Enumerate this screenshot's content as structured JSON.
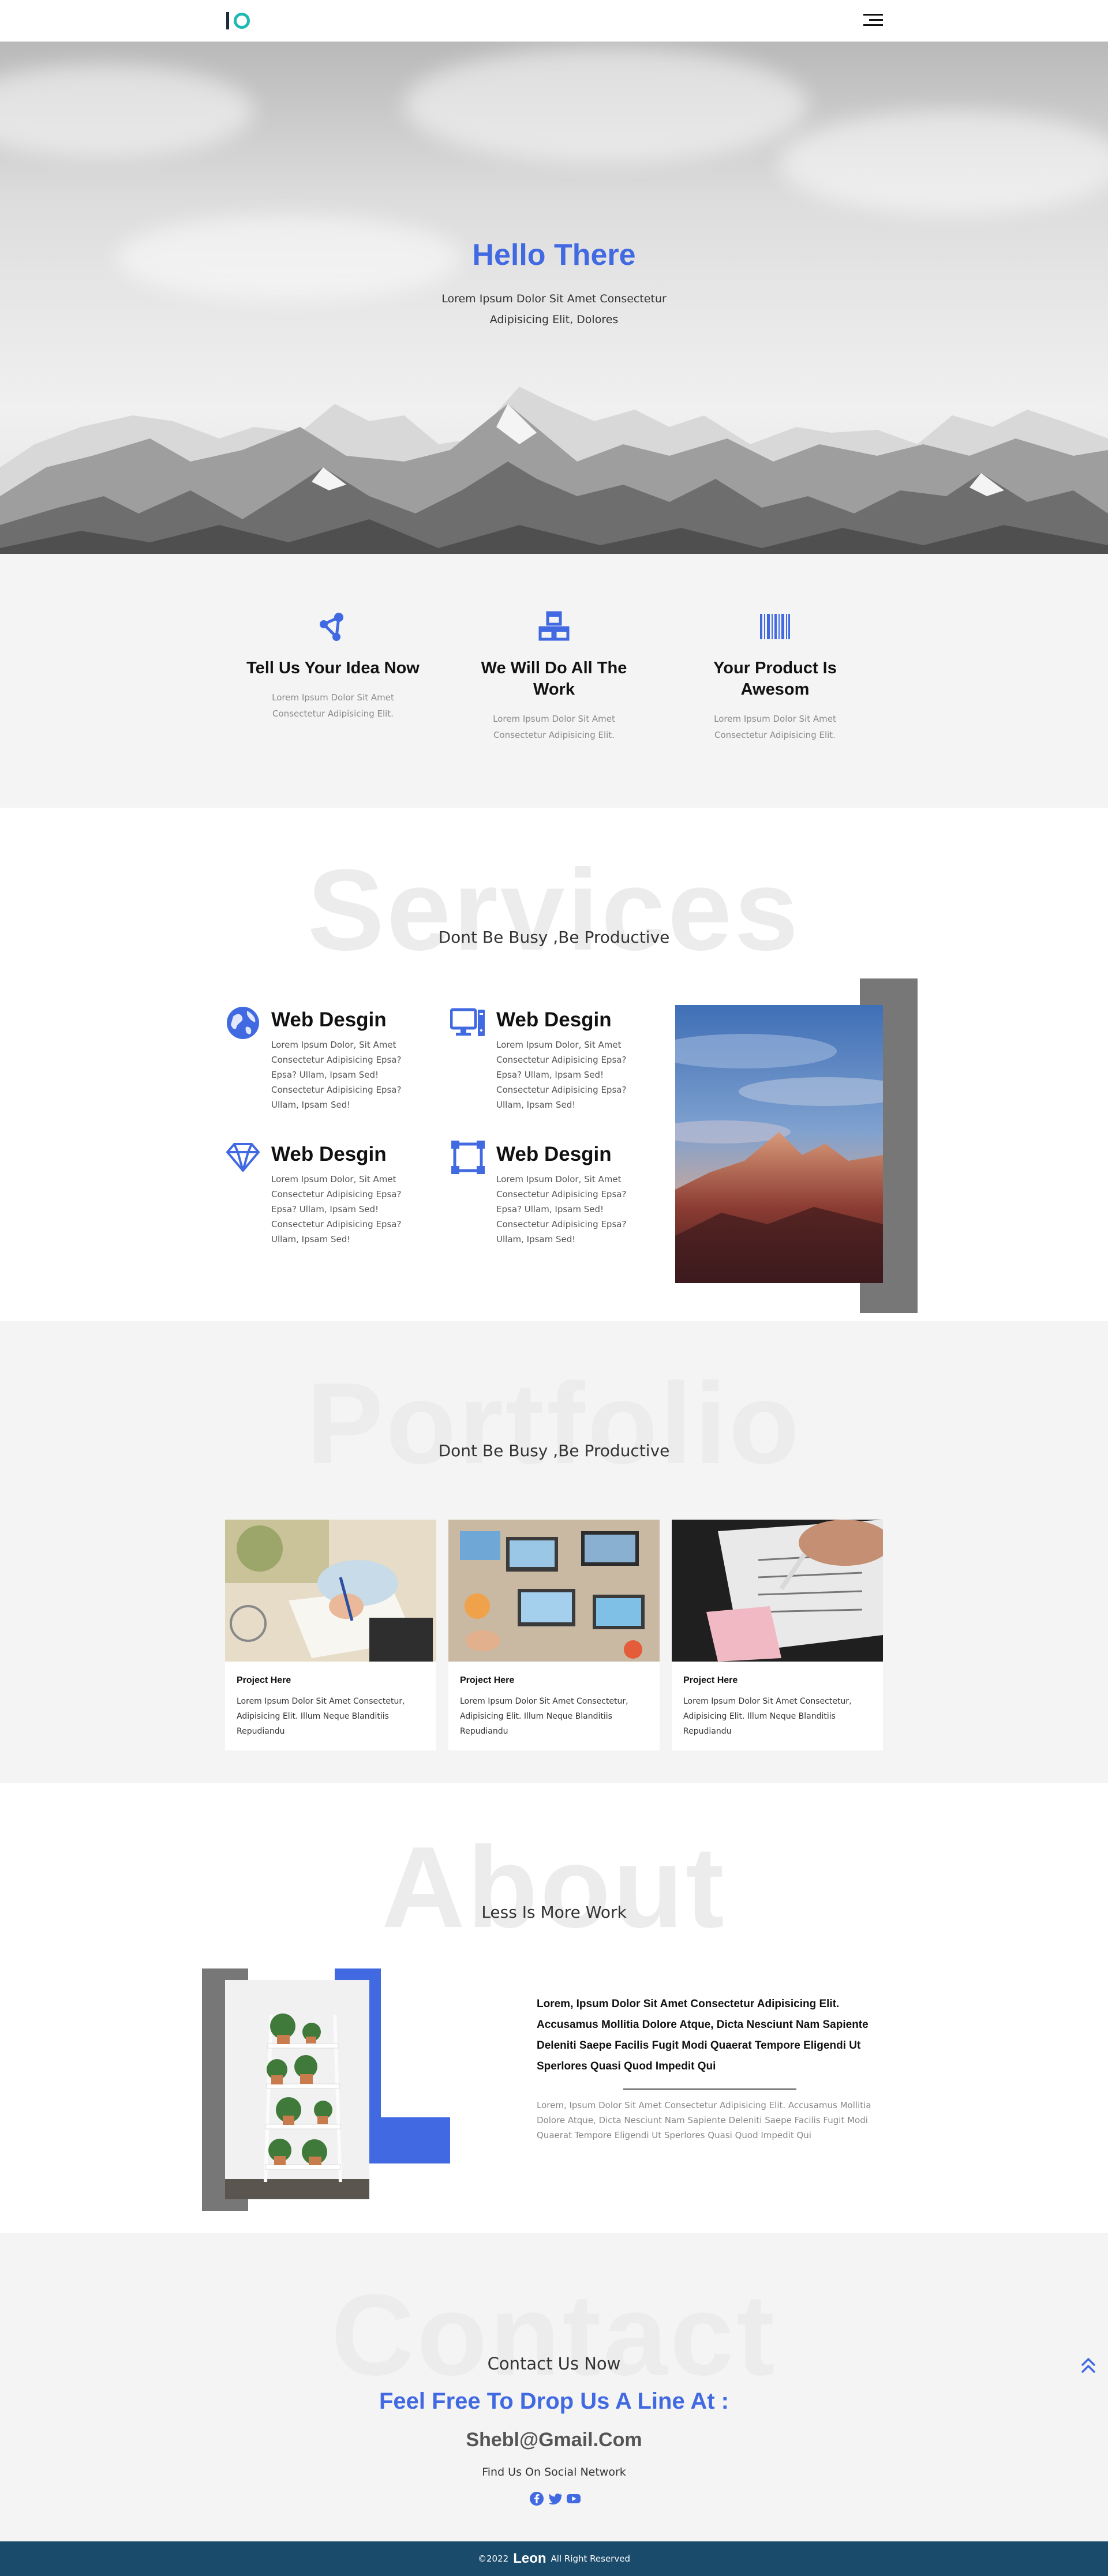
{
  "header": {
    "logo_text": "IO",
    "menu_icon": "hamburger-menu-icon"
  },
  "hero": {
    "title": "Hello There",
    "text": "Lorem Ipsum Dolor Sit Amet Consectetur Adipisicing Elit, Dolores"
  },
  "steps": [
    {
      "icon": "share-nodes-icon",
      "title": "Tell Us Your Idea Now",
      "text": "Lorem Ipsum Dolor Sit Amet Consectetur Adipisicing Elit."
    },
    {
      "icon": "cubes-icon",
      "title": "We Will Do All The Work",
      "text": "Lorem Ipsum Dolor Sit Amet Consectetur Adipisicing Elit."
    },
    {
      "icon": "barcode-icon",
      "title": "Your Product Is Awesom",
      "text": "Lorem Ipsum Dolor Sit Amet Consectetur Adipisicing Elit."
    }
  ],
  "services": {
    "bg_word": "Services",
    "subtitle": "Dont Be Busy ,Be Productive",
    "items": [
      {
        "icon": "globe-icon",
        "title": "Web Desgin",
        "text": "Lorem Ipsum Dolor, Sit Amet Consectetur Adipisicing Epsa? Epsa? Ullam, Ipsam Sed! Consectetur Adipisicing Epsa? Ullam, Ipsam Sed!"
      },
      {
        "icon": "desktop-computer-icon",
        "title": "Web Desgin",
        "text": "Lorem Ipsum Dolor, Sit Amet Consectetur Adipisicing Epsa? Epsa? Ullam, Ipsam Sed! Consectetur Adipisicing Epsa? Ullam, Ipsam Sed!"
      },
      {
        "icon": "diamond-gem-icon",
        "title": "Web Desgin",
        "text": "Lorem Ipsum Dolor, Sit Amet Consectetur Adipisicing Epsa? Epsa? Ullam, Ipsam Sed! Consectetur Adipisicing Epsa? Ullam, Ipsam Sed!"
      },
      {
        "icon": "vector-square-icon",
        "title": "Web Desgin",
        "text": "Lorem Ipsum Dolor, Sit Amet Consectetur Adipisicing Epsa? Epsa? Ullam, Ipsam Sed! Consectetur Adipisicing Epsa? Ullam, Ipsam Sed!"
      }
    ]
  },
  "portfolio": {
    "bg_word": "Portfolio",
    "subtitle": "Dont Be Busy ,Be Productive",
    "cards": [
      {
        "title": "Project Here",
        "text": "Lorem Ipsum Dolor Sit Amet Consectetur, Adipisicing Elit. Illum Neque Blanditiis Repudiandu"
      },
      {
        "title": "Project Here",
        "text": "Lorem Ipsum Dolor Sit Amet Consectetur, Adipisicing Elit. Illum Neque Blanditiis Repudiandu"
      },
      {
        "title": "Project Here",
        "text": "Lorem Ipsum Dolor Sit Amet Consectetur, Adipisicing Elit. Illum Neque Blanditiis Repudiandu"
      }
    ]
  },
  "about": {
    "bg_word": "About",
    "subtitle": "Less Is More Work",
    "lead": "Lorem, Ipsum Dolor Sit Amet Consectetur Adipisicing Elit. Accusamus Mollitia Dolore Atque, Dicta Nesciunt Nam Sapiente Deleniti Saepe Facilis Fugit Modi Quaerat Tempore Eligendi Ut Sperlores Quasi Quod Impedit Qui",
    "text": "Lorem, Ipsum Dolor Sit Amet Consectetur Adipisicing Elit. Accusamus Mollitia Dolore Atque, Dicta Nesciunt Nam Sapiente Deleniti Saepe Facilis Fugit Modi Quaerat Tempore Eligendi Ut Sperlores Quasi Quod Impedit Qui"
  },
  "contact": {
    "bg_word": "Contact",
    "subtitle": "Contact Us Now",
    "headline": "Feel Free To Drop Us A Line At :",
    "email": "Shebl@Gmail.Com",
    "social_label": "Find Us On Social Network",
    "socials": [
      "facebook-icon",
      "twitter-icon",
      "youtube-icon"
    ],
    "to_top_icon": "double-chevron-up-icon"
  },
  "footer": {
    "prefix": "©2022",
    "brand": "Leon",
    "suffix": "All Right Reserved"
  },
  "colors": {
    "accent": "#4169e1",
    "footer": "#1b4b6b",
    "gray_block": "#777777",
    "logo_ring": "#1fb8b3"
  }
}
